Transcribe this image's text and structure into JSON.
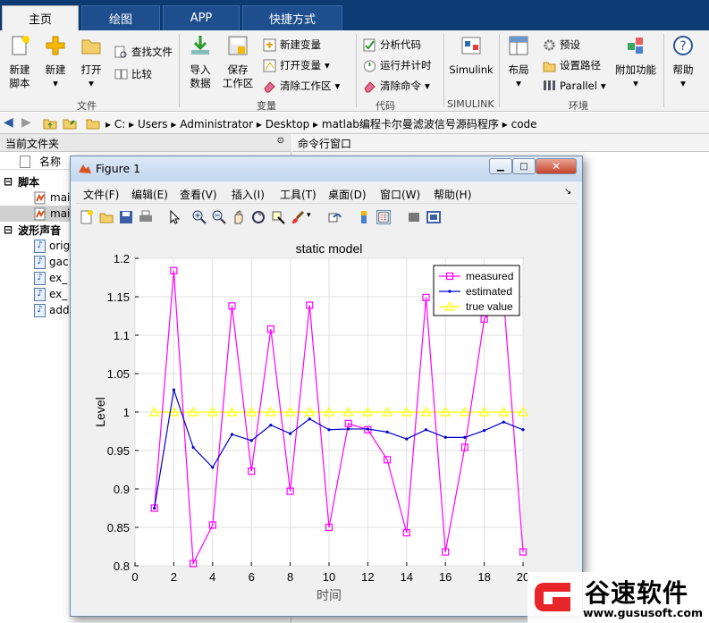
{
  "tabs": [
    "主页",
    "绘图",
    "APP",
    "快捷方式"
  ],
  "ribbon": {
    "new_script": "新建\n脚本",
    "new": "新建",
    "open": "打开",
    "find_files": "查找文件",
    "compare": "比较",
    "import": "导入\n数据",
    "save_ws": "保存\n工作区",
    "new_var": "新建变量",
    "open_var": "打开变量",
    "clear_ws": "清除工作区",
    "analyze": "分析代码",
    "run_time": "运行并计时",
    "clear_cmd": "清除命令",
    "simulink": "Simulink",
    "layout": "布局",
    "prefs": "预设",
    "set_path": "设置路径",
    "parallel": "Parallel",
    "addons": "附加功能",
    "help": "帮助",
    "groups": [
      "文件",
      "变量",
      "代码",
      "SIMULINK",
      "环境"
    ]
  },
  "address": {
    "path": [
      "C:",
      "Users",
      "Administrator",
      "Desktop",
      "matlab编程卡尔曼滤波信号源码程序",
      "code"
    ]
  },
  "panels": {
    "current_folder": "当前文件夹",
    "command_window": "命令行窗口",
    "name_col": "名称"
  },
  "files": {
    "group1": "脚本",
    "scripts": [
      "mai",
      "mai"
    ],
    "group2": "波形声音",
    "sounds": [
      "origi",
      "gac",
      "ex_",
      "ex_",
      "add"
    ]
  },
  "figure": {
    "title": "Figure 1",
    "menu": [
      "文件(F)",
      "编辑(E)",
      "查看(V)",
      "插入(I)",
      "工具(T)",
      "桌面(D)",
      "窗口(W)",
      "帮助(H)"
    ]
  },
  "chart_data": {
    "type": "line",
    "title": "static model",
    "xlabel": "时间",
    "ylabel": "Level",
    "xlim": [
      0,
      20
    ],
    "ylim": [
      0.8,
      1.2
    ],
    "xticks": [
      "0",
      "2",
      "4",
      "6",
      "8",
      "10",
      "12",
      "14",
      "16",
      "18",
      "20"
    ],
    "yticks": [
      "0.8",
      "0.85",
      "0.9",
      "0.95",
      "1",
      "1.05",
      "1.1",
      "1.15",
      "1.2"
    ],
    "grid": true,
    "legend_position": "top-right",
    "x": [
      1,
      2,
      3,
      4,
      5,
      6,
      7,
      8,
      9,
      10,
      11,
      12,
      13,
      14,
      15,
      16,
      17,
      18,
      19,
      20
    ],
    "series": [
      {
        "name": "measured",
        "color": "#ff00ff",
        "marker": "square",
        "values": [
          0.875,
          1.184,
          0.803,
          0.853,
          1.138,
          0.923,
          1.108,
          0.897,
          1.139,
          0.85,
          0.985,
          0.977,
          0.938,
          0.843,
          1.149,
          0.818,
          0.954,
          1.121,
          1.148,
          0.818
        ]
      },
      {
        "name": "estimated",
        "color": "#0000cc",
        "marker": "dot",
        "values": [
          0.875,
          1.029,
          0.954,
          0.928,
          0.971,
          0.963,
          0.983,
          0.972,
          0.991,
          0.977,
          0.978,
          0.978,
          0.974,
          0.965,
          0.977,
          0.967,
          0.967,
          0.976,
          0.987,
          0.977
        ]
      },
      {
        "name": "true value",
        "color": "#ffff00",
        "marker": "triangle",
        "values": [
          1,
          1,
          1,
          1,
          1,
          1,
          1,
          1,
          1,
          1,
          1,
          1,
          1,
          1,
          1,
          1,
          1,
          1,
          1,
          1
        ]
      }
    ]
  },
  "watermark": {
    "brand": "谷速软件",
    "url": "www.gususoft.com"
  }
}
